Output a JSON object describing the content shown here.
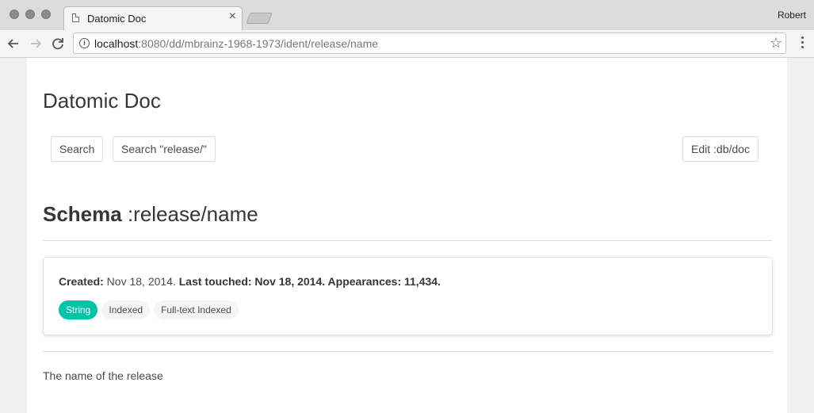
{
  "browser": {
    "tab_title": "Datomic Doc",
    "tab_close": "×",
    "profile_name": "Robert",
    "url_host": "localhost",
    "url_rest": ":8080/dd/mbrainz-1968-1973/ident/release/name",
    "star_glyph": "☆",
    "info_glyph": "i"
  },
  "page": {
    "site_title": "Datomic Doc",
    "search_button": "Search",
    "search_scope_button": "Search \"release/\"",
    "edit_button": "Edit :db/doc",
    "schema_label": "Schema",
    "schema_ident": " :release/name",
    "meta": {
      "created_label": "Created:",
      "created_value": " Nov 18, 2014. ",
      "touched_label": "Last touched: Nov 18, 2014.",
      "appearances_label": " Appearances: 11,434."
    },
    "tags": [
      "String",
      "Indexed",
      "Full-text Indexed"
    ],
    "description": "The name of the release"
  },
  "colors": {
    "accent": "#00c4a7",
    "text": "#4a4a4a",
    "heading": "#363636"
  }
}
